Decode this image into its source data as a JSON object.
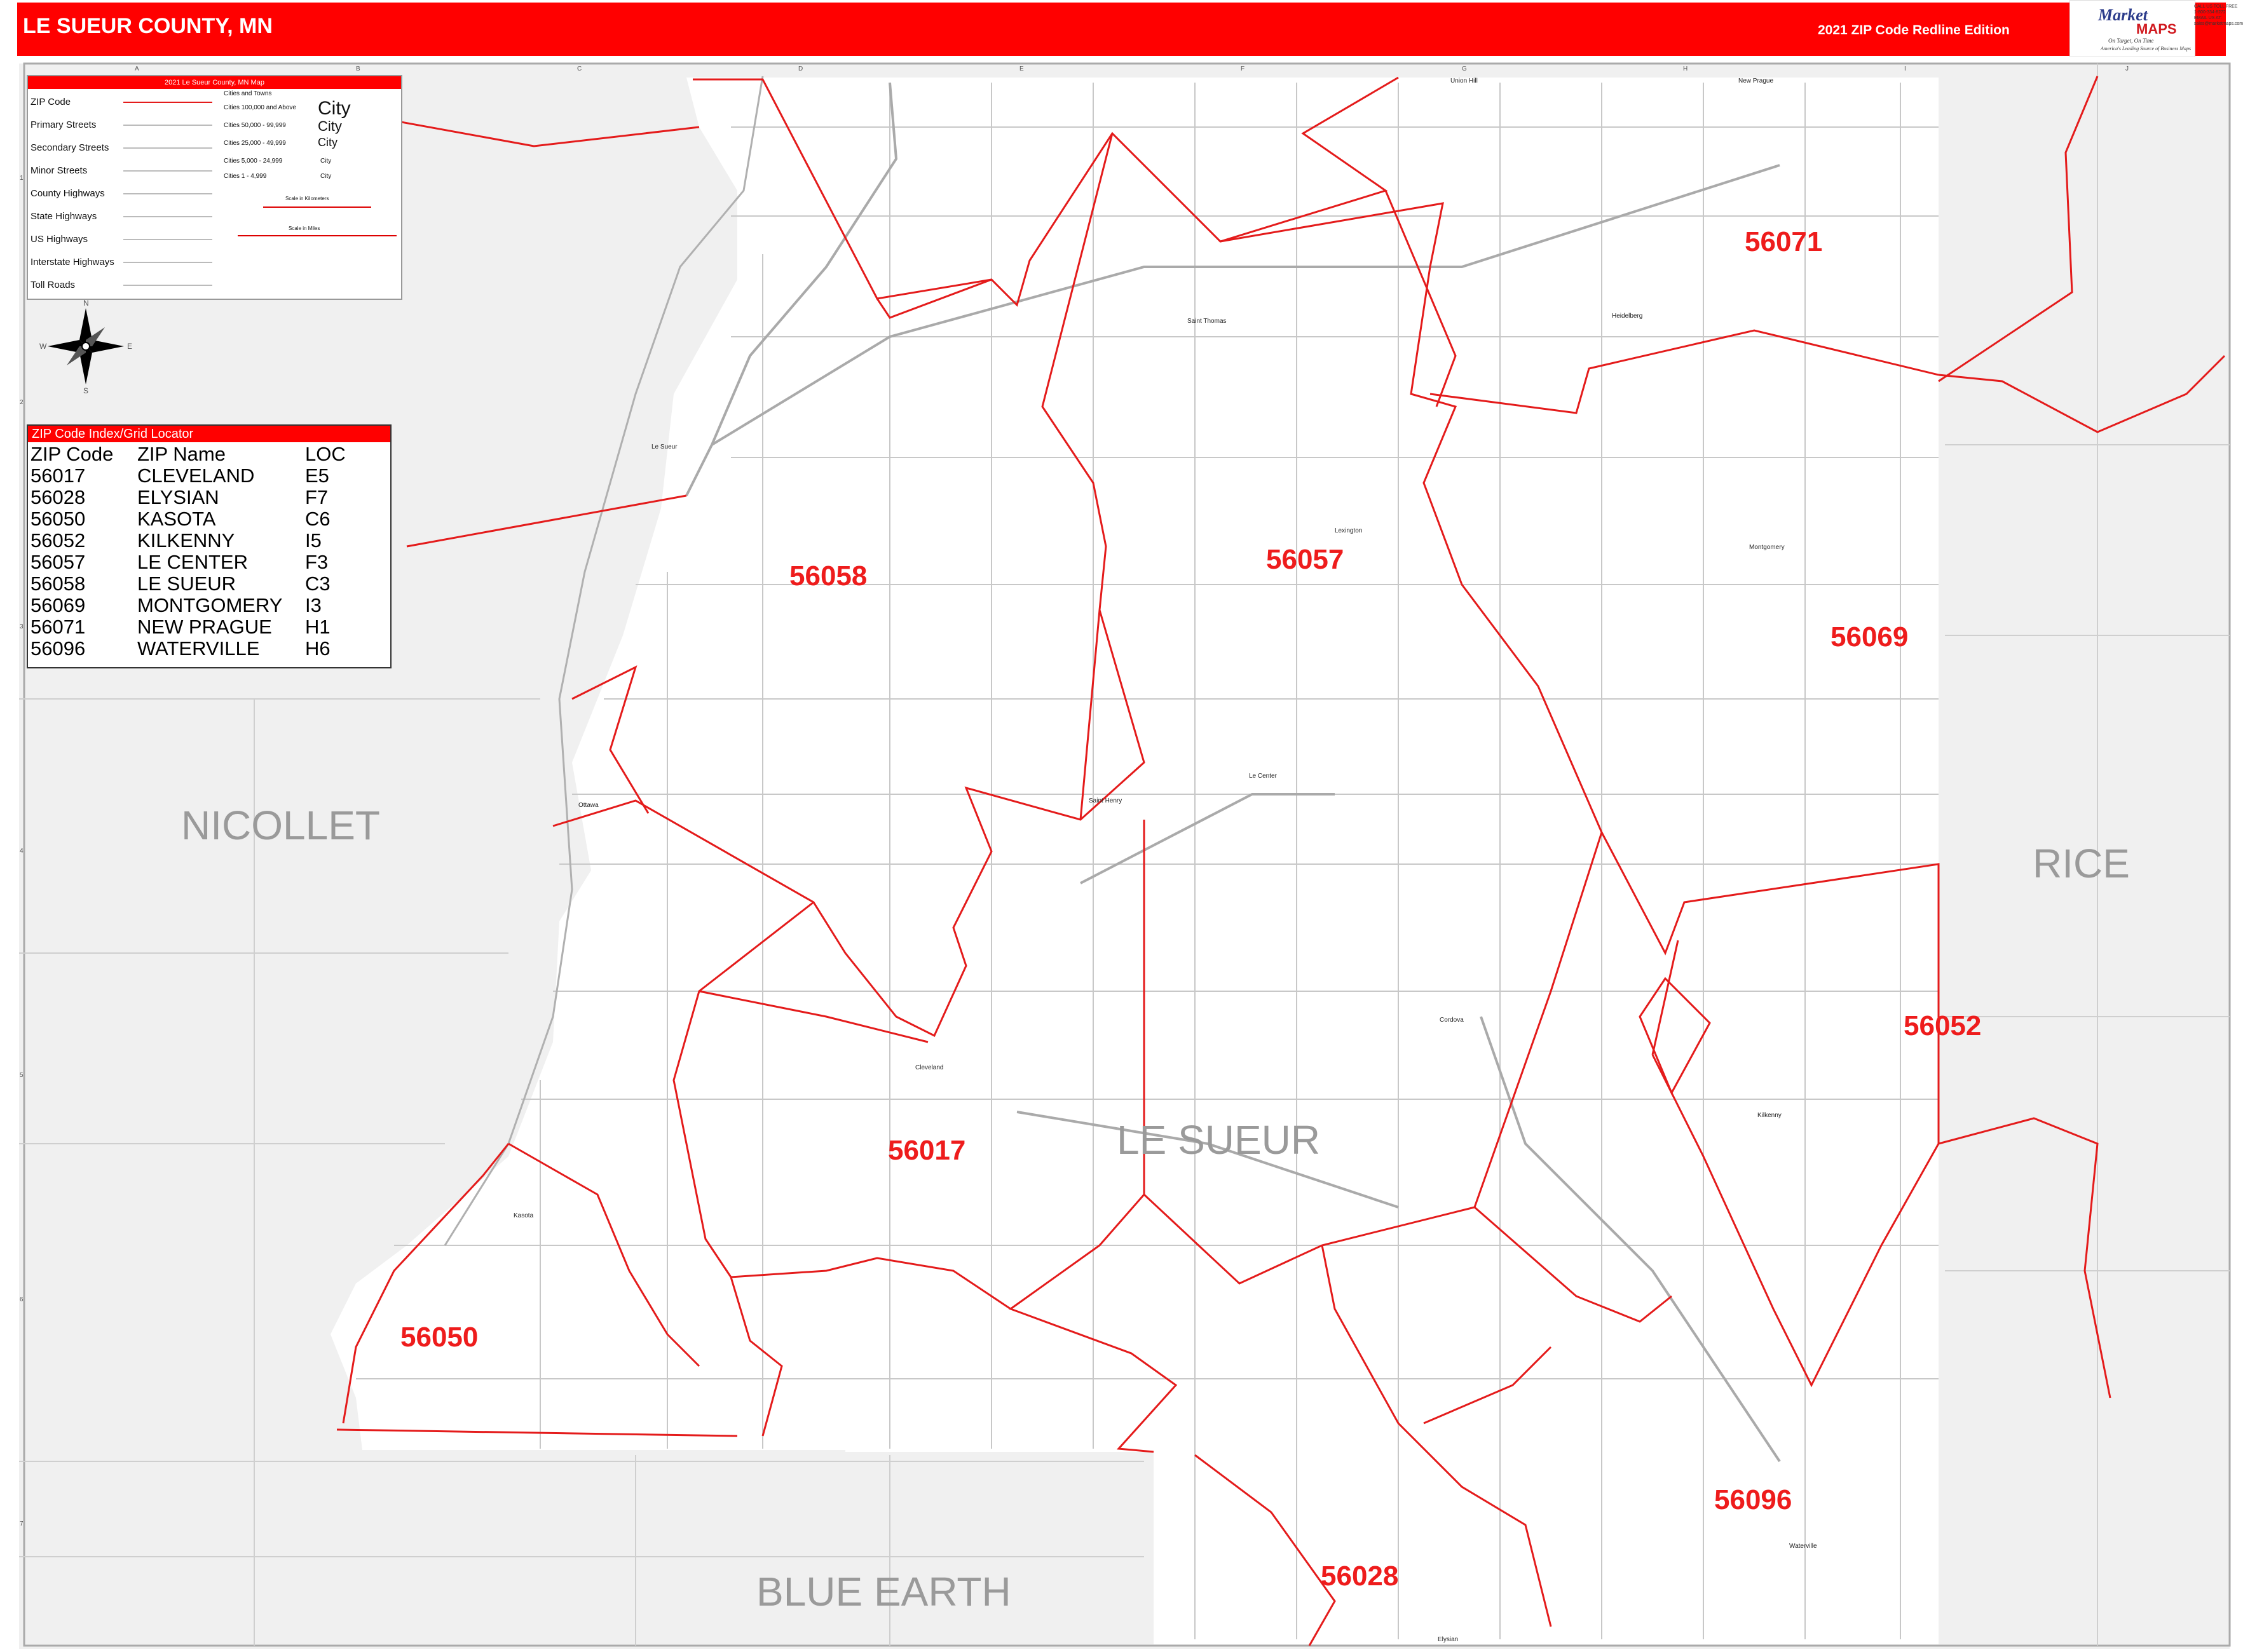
{
  "header": {
    "title": "LE SUEUR COUNTY, MN",
    "edition": "2021 ZIP Code Redline Edition"
  },
  "logo": {
    "word1": "Market",
    "word2": "MAPS",
    "tagline": "On Target, On Time",
    "subtagline": "America's Leading Source of Business Maps",
    "contact": "CALL US TOLL FREE 1-800-334-8272 EMAIL US AT: sales@marketmaps.com"
  },
  "legend": {
    "title": "2021 Le Sueur County, MN Map",
    "items": [
      "ZIP Code",
      "Primary Streets",
      "Secondary Streets",
      "Minor Streets",
      "County Highways",
      "State Highways",
      "US Highways",
      "Interstate Highways",
      "Toll Roads"
    ],
    "cities_title": "Cities and Towns",
    "cities": [
      {
        "range": "Cities 100,000 and Above",
        "sample": "City"
      },
      {
        "range": "Cities 50,000 - 99,999",
        "sample": "City"
      },
      {
        "range": "Cities 25,000 - 49,999",
        "sample": "City"
      },
      {
        "range": "Cities 5,000 - 24,999",
        "sample": "City"
      },
      {
        "range": "Cities 1 - 4,999",
        "sample": "City"
      }
    ],
    "scale_km": "Scale in Kilometers",
    "scale_mi": "Scale in Miles"
  },
  "compass": {
    "n": "N",
    "s": "S",
    "e": "E",
    "w": "W"
  },
  "index": {
    "title": "ZIP Code Index/Grid Locator",
    "headers": [
      "ZIP Code",
      "ZIP Name",
      "LOC"
    ],
    "rows": [
      [
        "56017",
        "CLEVELAND",
        "E5"
      ],
      [
        "56028",
        "ELYSIAN",
        "F7"
      ],
      [
        "56050",
        "KASOTA",
        "C6"
      ],
      [
        "56052",
        "KILKENNY",
        "I5"
      ],
      [
        "56057",
        "LE CENTER",
        "F3"
      ],
      [
        "56058",
        "LE SUEUR",
        "C3"
      ],
      [
        "56069",
        "MONTGOMERY",
        "I3"
      ],
      [
        "56071",
        "NEW PRAGUE",
        "H1"
      ],
      [
        "56096",
        "WATERVILLE",
        "H6"
      ]
    ]
  },
  "zip_labels": [
    "56071",
    "56058",
    "56057",
    "56069",
    "56052",
    "56017",
    "56050",
    "56096",
    "56028"
  ],
  "counties": [
    "NICOLLET",
    "RICE",
    "LE SUEUR",
    "BLUE EARTH"
  ],
  "towns": [
    "Union Hill",
    "New Prague",
    "Saint Thomas",
    "Heidelberg",
    "Le Sueur",
    "Lexington",
    "Montgomery",
    "Le Center",
    "Saint Henry",
    "Ottawa",
    "Cordova",
    "Cleveland",
    "Kilkenny",
    "Kasota",
    "Waterville",
    "Elysian"
  ],
  "grid": {
    "letters": [
      "A",
      "B",
      "C",
      "D",
      "E",
      "F",
      "G",
      "H",
      "I",
      "J"
    ],
    "numbers": [
      "1",
      "2",
      "3",
      "4",
      "5",
      "6",
      "7"
    ]
  },
  "colors": {
    "zip_boundary": "#e41b1b",
    "header": "#ff0000",
    "outside_county": "#efefef"
  }
}
